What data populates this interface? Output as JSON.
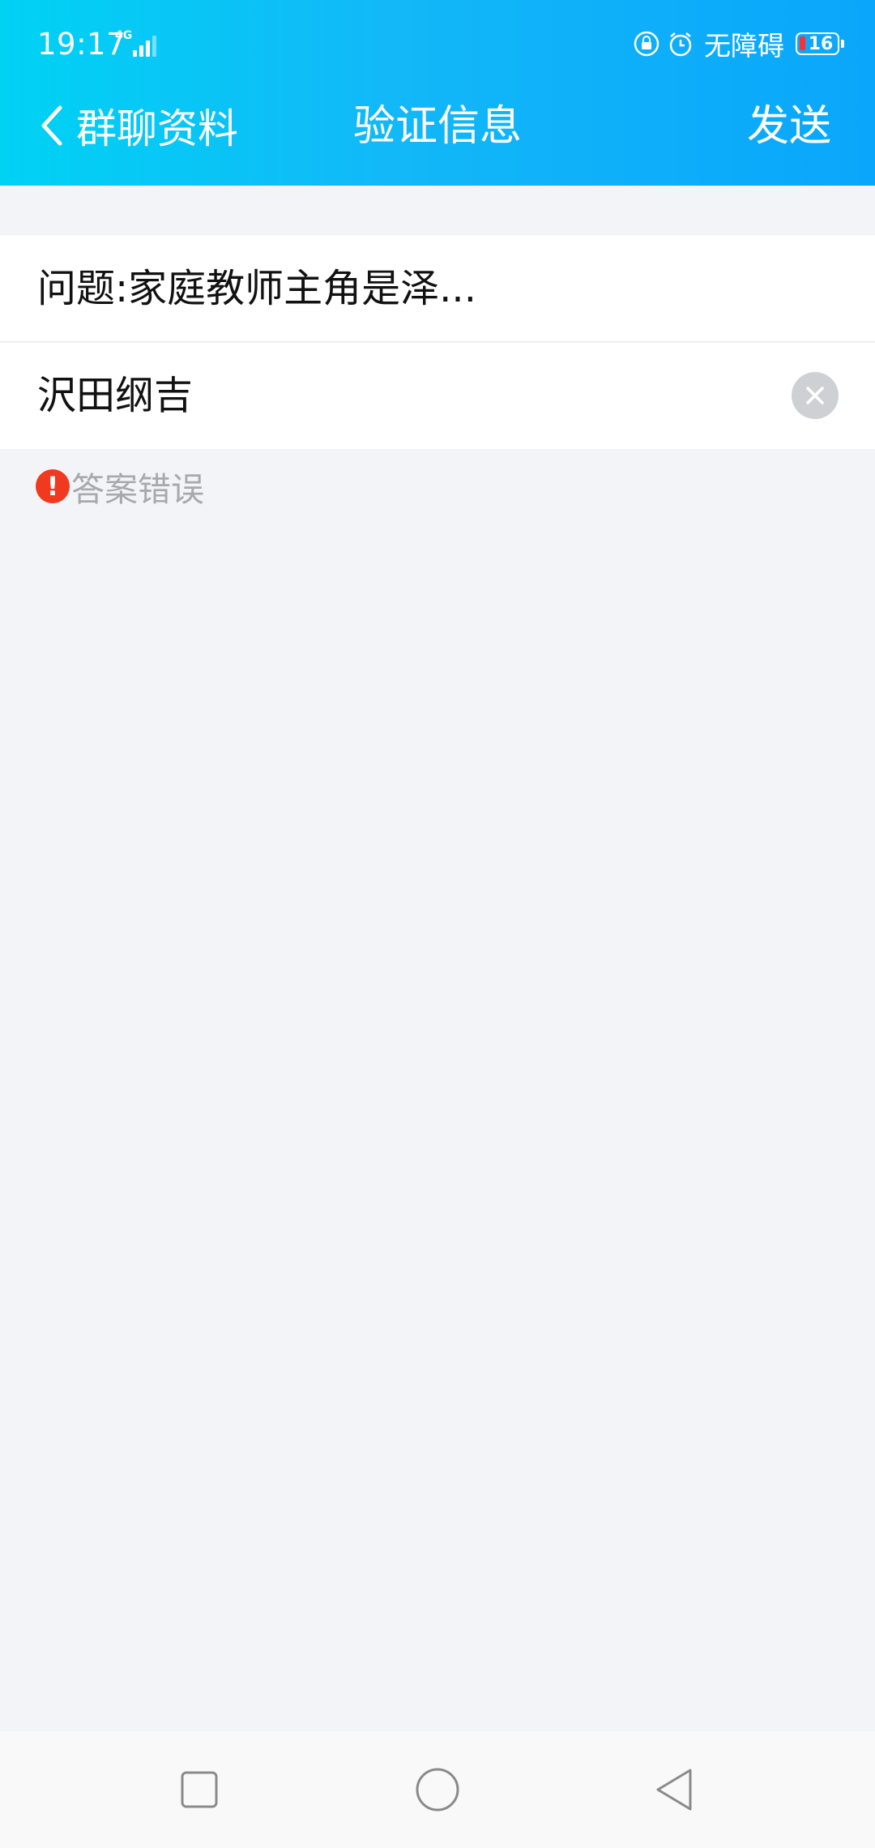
{
  "status_bar": {
    "time": "19:17",
    "network_label": "4G",
    "accessibility_label": "无障碍",
    "battery_level": "16",
    "battery_low_color": "#ff2f2f"
  },
  "header": {
    "back_label": "群聊资料",
    "title": "验证信息",
    "send_label": "发送",
    "gradient_colors": [
      "#00d2f4",
      "#0aa6fb"
    ]
  },
  "form": {
    "question": "问题:家庭教师主角是泽...",
    "answer_value": "沢田纲吉",
    "clear_icon": "close-icon",
    "error_message": "答案错误",
    "error_color": "#f0391f"
  },
  "navigation_bar": {
    "buttons": [
      "recent-apps",
      "home",
      "back"
    ]
  }
}
